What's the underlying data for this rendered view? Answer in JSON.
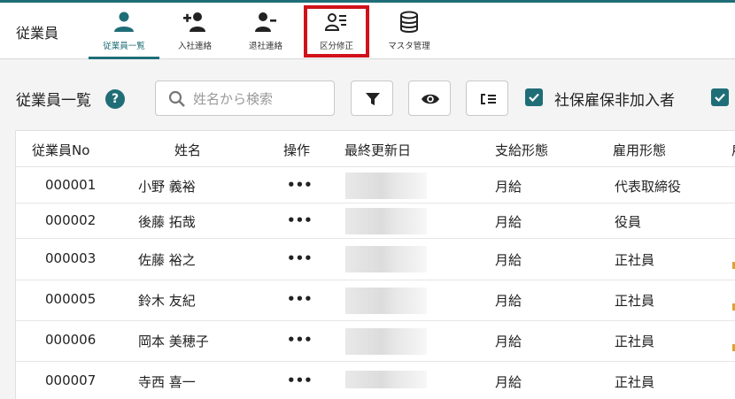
{
  "header": {
    "app_title": "従業員",
    "nav": [
      {
        "label": "従業員一覧",
        "icon": "person-icon"
      },
      {
        "label": "入社連絡",
        "icon": "person-add-icon"
      },
      {
        "label": "退社連絡",
        "icon": "person-remove-icon"
      },
      {
        "label": "区分修正",
        "icon": "person-list-edit-icon"
      },
      {
        "label": "マスタ管理",
        "icon": "database-icon"
      }
    ]
  },
  "toolbar": {
    "page_title": "従業員一覧",
    "help": "?",
    "search_placeholder": "姓名から検索",
    "search_value": "",
    "checkbox_label": "社保雇保非加入者"
  },
  "table": {
    "columns": [
      "従業員No",
      "姓名",
      "操作",
      "最終更新日",
      "支給形態",
      "雇用形態",
      "雇"
    ],
    "rows": [
      {
        "no": "000001",
        "name": "小野 義裕",
        "action": "•••",
        "pay": "月給",
        "employment": "代表取締役"
      },
      {
        "no": "000002",
        "name": "後藤 拓哉",
        "action": "•••",
        "pay": "月給",
        "employment": "役員"
      },
      {
        "no": "000003",
        "name": "佐藤 裕之",
        "action": "•••",
        "pay": "月給",
        "employment": "正社員"
      },
      {
        "no": "000005",
        "name": "鈴木 友紀",
        "action": "•••",
        "pay": "月給",
        "employment": "正社員"
      },
      {
        "no": "000006",
        "name": "岡本 美穂子",
        "action": "•••",
        "pay": "月給",
        "employment": "正社員"
      },
      {
        "no": "000007",
        "name": "寺西 喜一",
        "action": "•••",
        "pay": "月給",
        "employment": "正社員"
      }
    ]
  },
  "colors": {
    "accent": "#1f6e77",
    "highlight": "#d0121a"
  }
}
